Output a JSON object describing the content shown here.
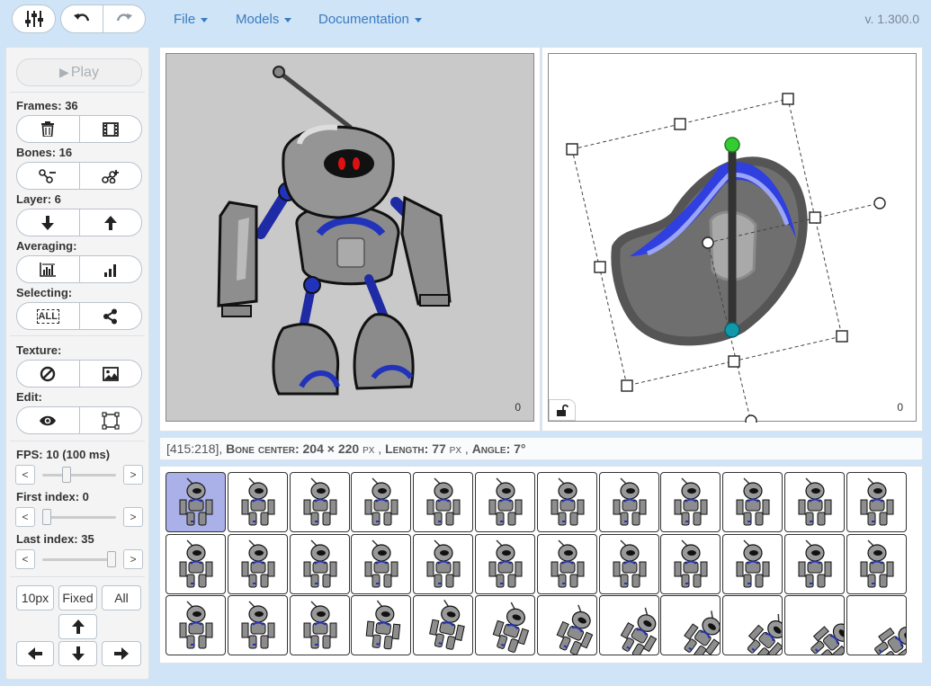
{
  "toolbar": {
    "mixer_icon": "sliders-icon",
    "undo_icon": "undo-icon",
    "redo_icon": "redo-icon"
  },
  "menus": [
    {
      "label": "File"
    },
    {
      "label": "Models"
    },
    {
      "label": "Documentation"
    }
  ],
  "version": "v. 1.300.0",
  "left_panel": {
    "play_label": "Play",
    "frames_label": "Frames: 36",
    "bones_label": "Bones: 16",
    "layer_label": "Layer: 6",
    "averaging_label": "Averaging:",
    "selecting_label": "Selecting:",
    "select_all_text": "ALL",
    "texture_label": "Texture:",
    "edit_label": "Edit:",
    "fps_label": "FPS: 10 (100 ms)",
    "first_index_label": "First index: 0",
    "last_index_label": "Last index: 35",
    "fps_value_fraction": 0.3,
    "first_index_fraction": 0.0,
    "last_index_fraction": 1.0,
    "arrow_left": "<",
    "arrow_right": ">",
    "step_10px": "10px",
    "step_fixed": "Fixed",
    "step_all": "All"
  },
  "viewport_left": {
    "frame_index": "0"
  },
  "viewport_right": {
    "frame_index": "0"
  },
  "status": {
    "coords": "[415:218],",
    "bone_center_label": "Bone center:",
    "bone_center_value": "204 × 220",
    "px1": "px",
    "length_label": "Length:",
    "length_value": "77",
    "px2": "px",
    "angle_label": "Angle:",
    "angle_value": "7°"
  },
  "frames": {
    "count": 36,
    "selected_index": 0
  },
  "colors": {
    "accent": "#3a7bbf",
    "bone_top": "#33cc33",
    "bone_bottom": "#1199aa",
    "robot_blue": "#2233bb",
    "selected_frame": "#aab0e8"
  }
}
